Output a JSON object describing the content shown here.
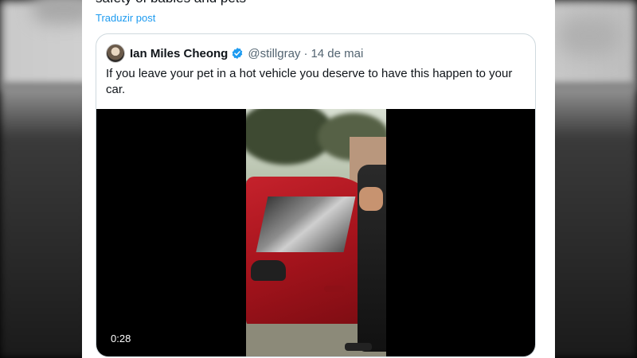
{
  "tweet": {
    "previous_text": "safety of babies and pets",
    "translate_label": "Traduzir post"
  },
  "quoted_tweet": {
    "display_name": "Ian Miles Cheong",
    "handle": "@stillgray",
    "separator": "·",
    "date": "14 de mai",
    "text": "If you leave your pet in a hot vehicle you deserve to have this happen to your car.",
    "video": {
      "duration": "0:28"
    }
  },
  "colors": {
    "link_blue": "#1d9bf0",
    "verified_blue": "#1d9bf0",
    "text_primary": "#0f1419",
    "text_secondary": "#536471"
  },
  "icons": {
    "verified": "verified-badge-icon"
  }
}
